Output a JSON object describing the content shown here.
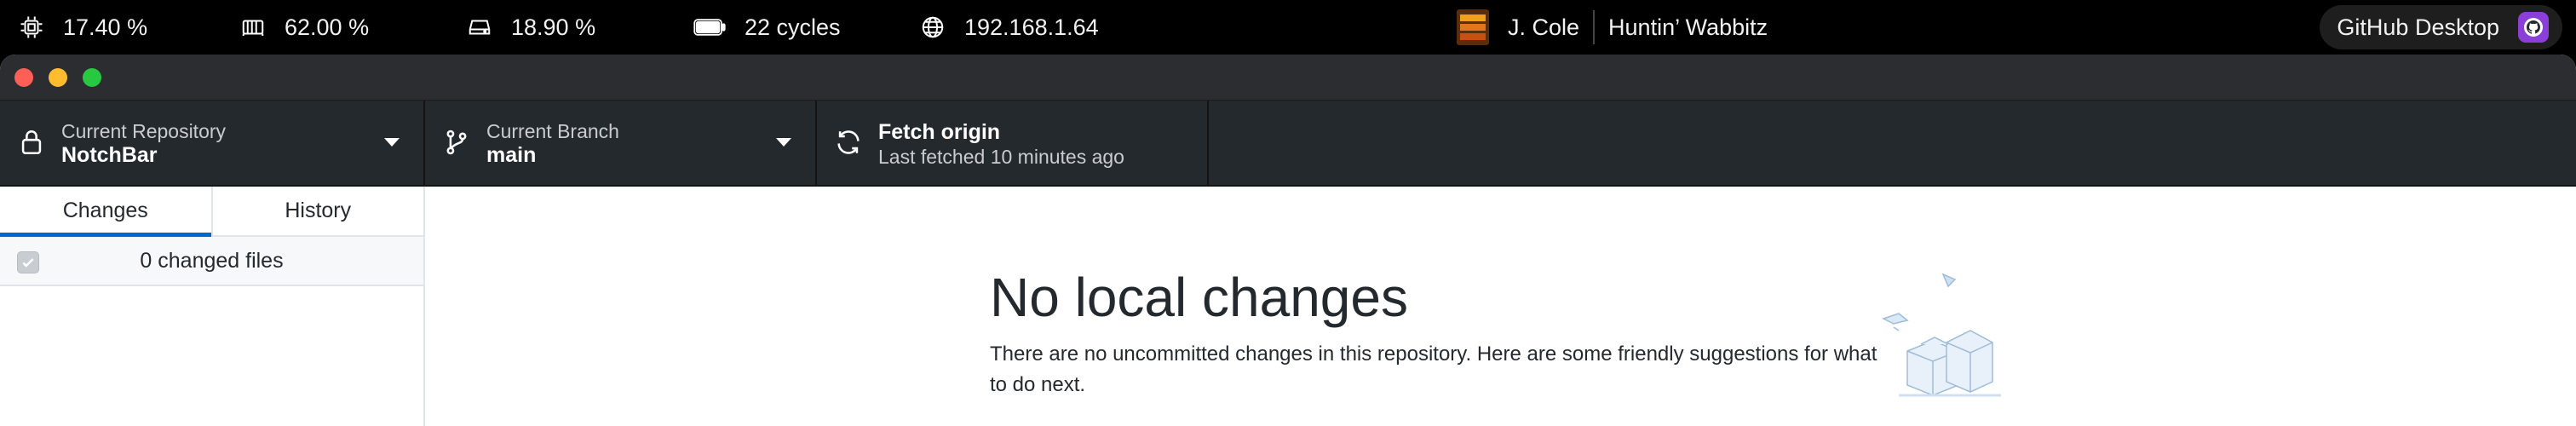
{
  "menubar": {
    "cpu": "17.40 %",
    "memory": "62.00 %",
    "disk": "18.90 %",
    "battery": "22 cycles",
    "ip": "192.168.1.64",
    "artist": "J. Cole",
    "track": "Huntin’ Wabbitz",
    "app": "GitHub Desktop"
  },
  "toolbar": {
    "repository": {
      "label": "Current Repository",
      "value": "NotchBar"
    },
    "branch": {
      "label": "Current Branch",
      "value": "main"
    },
    "fetch": {
      "label": "Fetch origin",
      "sub": "Last fetched 10 minutes ago"
    }
  },
  "sidebar": {
    "tabs": [
      {
        "label": "Changes",
        "active": true
      },
      {
        "label": "History",
        "active": false
      }
    ],
    "changed_files": "0 changed files"
  },
  "main": {
    "title": "No local changes",
    "description": "There are no uncommitted changes in this repository. Here are some friendly suggestions for what to do next."
  },
  "colors": {
    "toolbar_bg": "#24292e",
    "accent": "#0366d6",
    "close": "#ff5f57",
    "minimize": "#febc2e",
    "maximize": "#28c840"
  }
}
